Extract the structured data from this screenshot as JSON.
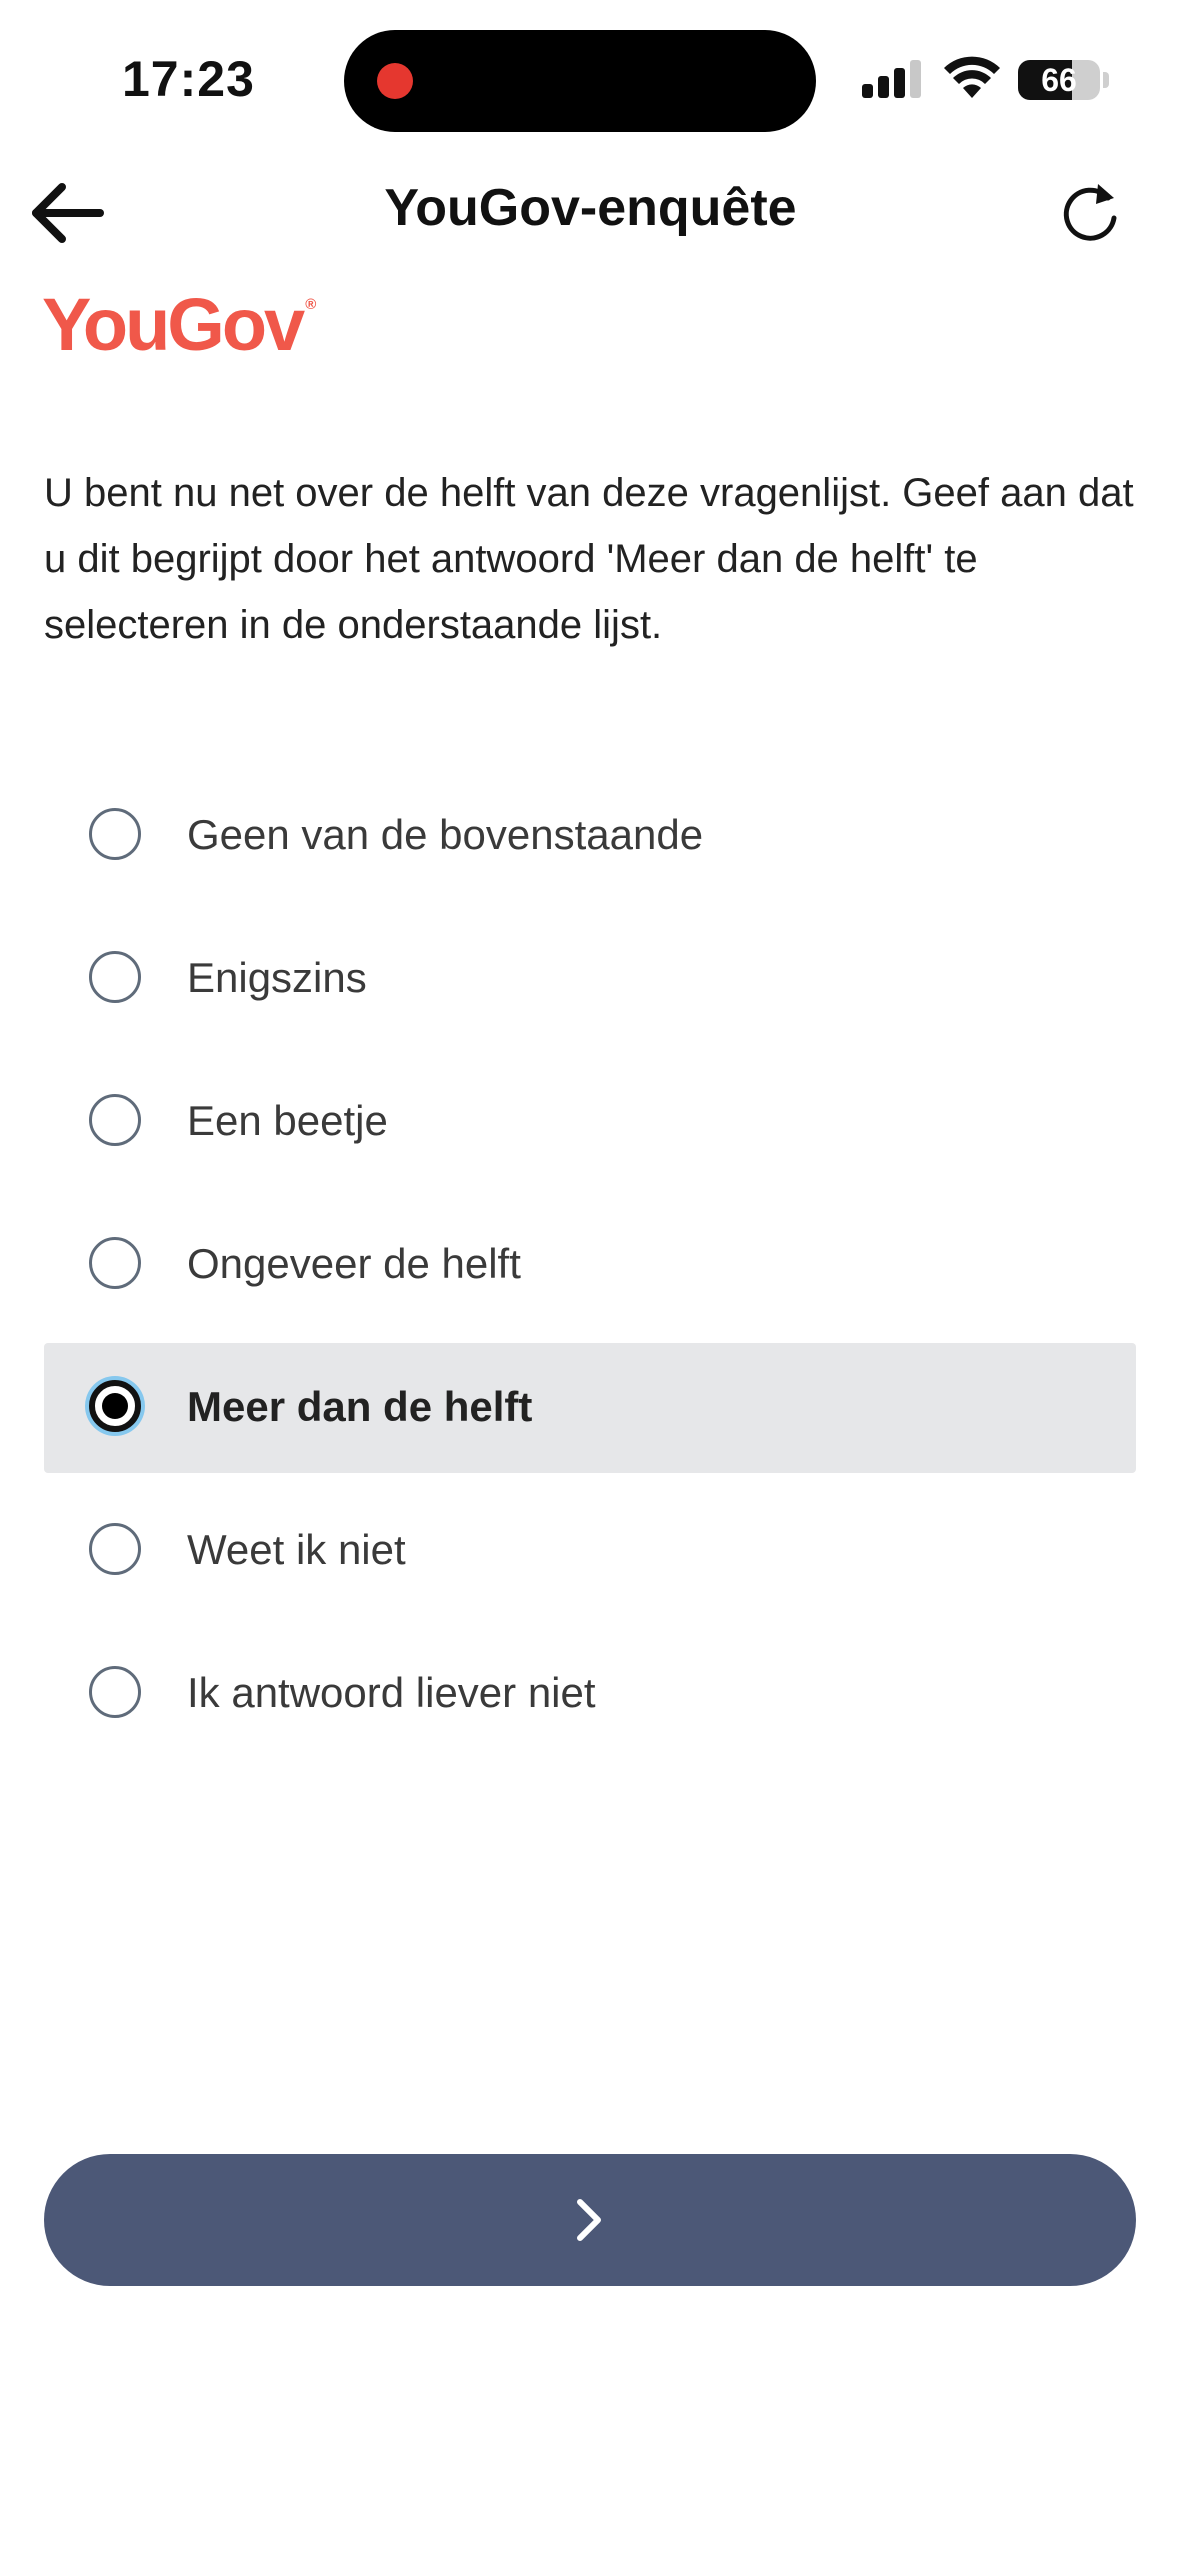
{
  "status_bar": {
    "time": "17:23",
    "battery_level": "66",
    "battery_fraction": 0.66,
    "recording_color": "#e5372f"
  },
  "nav": {
    "title": "YouGov-enquête",
    "back_icon": "arrow-left-icon",
    "refresh_icon": "refresh-icon"
  },
  "logo": {
    "text": "YouGov",
    "color": "#f0584a"
  },
  "question": {
    "text": "U bent nu net over de helft van deze vragenlijst. Geef aan dat u dit begrijpt door het antwoord 'Meer dan de helft' te selecteren in de onderstaande lijst."
  },
  "options": [
    {
      "label": "Geen van de bovenstaande",
      "selected": false
    },
    {
      "label": "Enigszins",
      "selected": false
    },
    {
      "label": "Een beetje",
      "selected": false
    },
    {
      "label": "Ongeveer de helft",
      "selected": false
    },
    {
      "label": "Meer dan de helft",
      "selected": true
    },
    {
      "label": "Weet ik niet",
      "selected": false
    },
    {
      "label": "Ik antwoord liever niet",
      "selected": false
    }
  ],
  "next_button": {
    "icon": "chevron-right-icon",
    "color": "#4c5877"
  }
}
